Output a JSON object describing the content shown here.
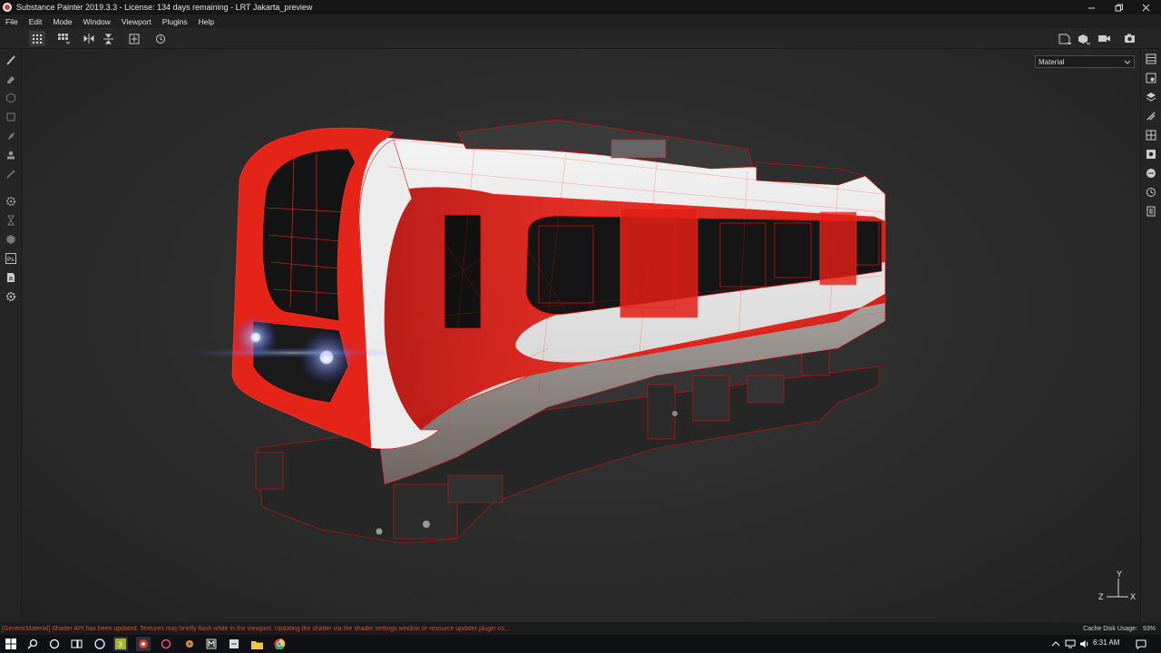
{
  "window": {
    "title": "Substance Painter 2019.3.3 - License: 134 days remaining - LRT Jakarta_preview",
    "controls": [
      "minimize",
      "restore",
      "close"
    ]
  },
  "menu": {
    "items": [
      "File",
      "Edit",
      "Mode",
      "Window",
      "Viewport",
      "Plugins",
      "Help"
    ]
  },
  "toolbar": {
    "left_icons": [
      "grid-view-icon",
      "grid-dropdown-icon",
      "symmetry-x-icon",
      "symmetry-y-icon",
      "add-frame-icon",
      "history-icon"
    ],
    "right_icons": [
      "display-settings-icon",
      "material-sphere-icon",
      "camera-icon",
      "screenshot-icon"
    ]
  },
  "left_tools": [
    "paint-brush-icon",
    "eraser-icon",
    "projection-icon",
    "geometry-mask-icon",
    "smudge-icon",
    "clone-stamp-icon",
    "color-picker-icon",
    "settings-icon",
    "bake-icon",
    "polygon-fill-icon",
    "photoshop-export-icon",
    "export-document-icon",
    "plugin-gear-icon"
  ],
  "right_panels": [
    "texture-set-list-icon",
    "texture-set-settings-icon",
    "layers-icon",
    "properties-icon",
    "display-grid-icon",
    "viewer-settings-icon",
    "shelf-icon",
    "history-panel-icon",
    "log-icon"
  ],
  "viewport": {
    "channel_select": "Material",
    "axis_labels": {
      "y": "Y",
      "z": "Z",
      "x": "X"
    }
  },
  "status": {
    "message": "[GenericMaterial] Shader API has been updated. Textures may briefly flash white in the viewport. Updating the shader via the shader settings window or resource updater plugin co...",
    "cache_label": "Cache Disk Usage:",
    "cache_value": "93%"
  },
  "taskbar": {
    "time": "6:31 AM",
    "apps": [
      "windows-start-icon",
      "search-icon",
      "cortana-icon",
      "task-view-icon",
      "blender-icon",
      "substance-3-icon",
      "substance-painter-icon",
      "substance-designer-icon",
      "blender-alt-icon",
      "marmoset-icon",
      "unity-icon",
      "file-explorer-icon",
      "chrome-icon"
    ]
  },
  "colors": {
    "accent_red": "#d9271c",
    "status_error": "#d1502f",
    "viewport_bg": "#2d2d2d"
  }
}
